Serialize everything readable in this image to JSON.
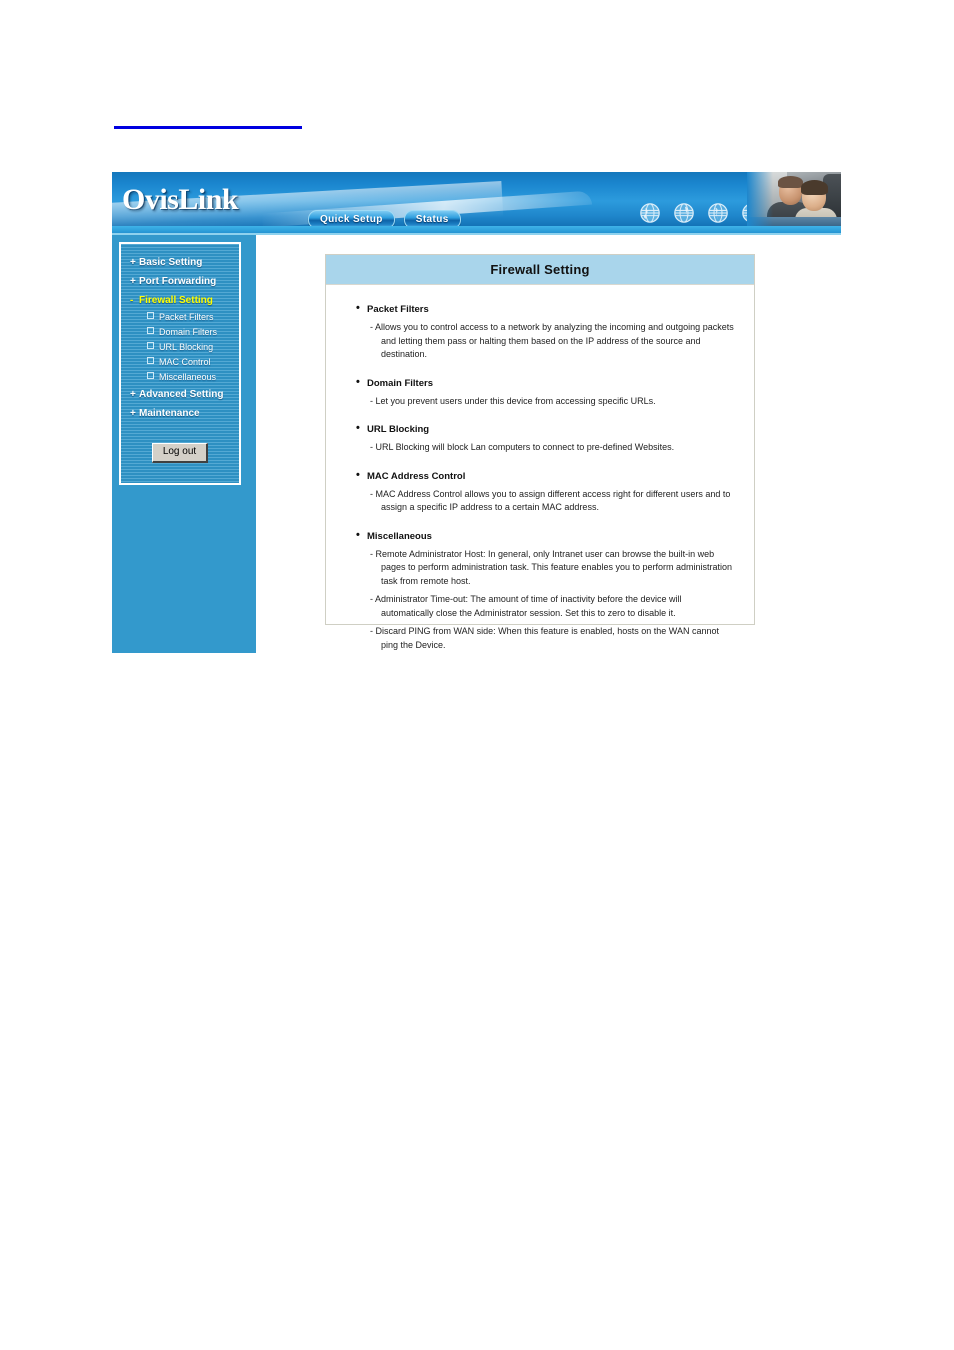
{
  "top_rule": {
    "name": "empty-hyperlink-rule",
    "color": "#0000E0"
  },
  "header": {
    "brand": "OvisLink",
    "pills": [
      {
        "label": "Quick Setup"
      },
      {
        "label": "Status"
      }
    ],
    "icons": [
      "globe-icon",
      "globe-icon",
      "globe-icon",
      "globe-icon"
    ],
    "photo_alt": "man-and-child-at-computer-photo"
  },
  "sidebar": {
    "items": [
      {
        "symbol": "+",
        "label": "Basic Setting",
        "active": false
      },
      {
        "symbol": "+",
        "label": "Port Forwarding",
        "active": false
      },
      {
        "symbol": "-",
        "label": "Firewall Setting",
        "active": true
      },
      {
        "symbol": "+",
        "label": "Advanced Setting",
        "active": false
      },
      {
        "symbol": "+",
        "label": "Maintenance",
        "active": false
      }
    ],
    "subitems": [
      {
        "label": "Packet Filters"
      },
      {
        "label": "Domain Filters"
      },
      {
        "label": "URL Blocking"
      },
      {
        "label": "MAC Control"
      },
      {
        "label": "Miscellaneous"
      }
    ],
    "logout_label": "Log out",
    "accent_color": "#3399CC",
    "active_color": "#FFFF00"
  },
  "main": {
    "title": "Firewall Setting",
    "title_bg": "#A9D5EB",
    "sections": [
      {
        "heading": "Packet Filters",
        "lines": [
          "- Allows you to control access to a network by analyzing the incoming and outgoing packets and letting them pass or halting them based on the IP address of the source and destination."
        ]
      },
      {
        "heading": "Domain Filters",
        "lines": [
          "- Let you prevent users under this device from accessing specific URLs."
        ]
      },
      {
        "heading": "URL Blocking",
        "lines": [
          "- URL Blocking will block Lan computers to connect to pre-defined Websites."
        ]
      },
      {
        "heading": "MAC Address Control",
        "lines": [
          "- MAC Address Control allows you to assign different access right for different users and to assign a specific IP address to a certain MAC address."
        ]
      },
      {
        "heading": "Miscellaneous",
        "lines": [
          "- Remote Administrator Host: In general, only Intranet user can browse the built-in web pages to perform administration task. This feature enables you to perform administration task from remote host.",
          "- Administrator Time-out: The amount of time of inactivity before the device will automatically close the Administrator session. Set this to zero to disable it.",
          "- Discard PING from WAN side: When this feature is enabled, hosts on the WAN cannot ping the Device."
        ]
      }
    ]
  }
}
